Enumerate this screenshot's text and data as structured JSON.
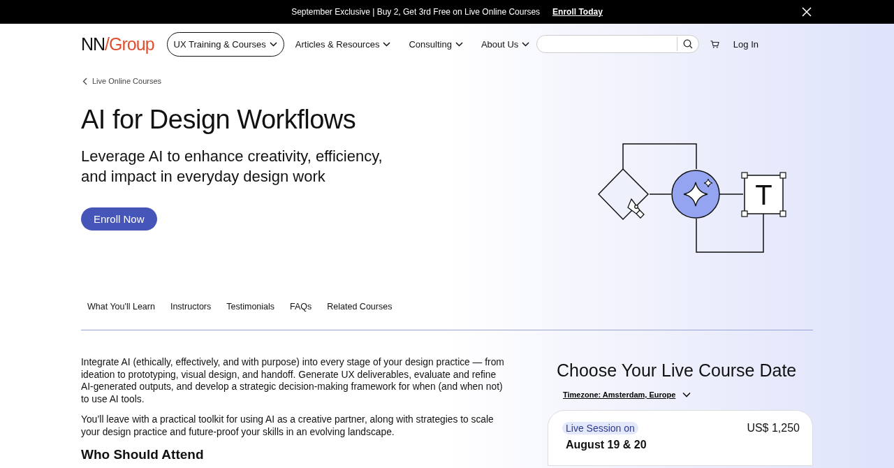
{
  "announcement": {
    "text": "September Exclusive | Buy 2, Get 3rd Free on Live Online Courses",
    "link": "Enroll Today"
  },
  "header": {
    "logo_left": "NN",
    "logo_slash": "/",
    "logo_right": "Group",
    "nav": [
      {
        "label": "UX Training & Courses",
        "selected": true
      },
      {
        "label": "Articles & Resources",
        "selected": false
      },
      {
        "label": "Consulting",
        "selected": false
      },
      {
        "label": "About Us",
        "selected": false
      }
    ],
    "login": "Log In"
  },
  "breadcrumb": "Live Online Courses",
  "hero": {
    "title": "AI for Design Workflows",
    "subtitle": "Leverage AI to enhance creativity, efficiency, and impact in everyday design work",
    "button": "Enroll Now",
    "illustration_letter": "T"
  },
  "tabs": [
    {
      "label": "What You'll Learn",
      "selected": false
    },
    {
      "label": "Instructors",
      "selected": false
    },
    {
      "label": "Testimonials",
      "selected": false
    },
    {
      "label": "FAQs",
      "selected": false
    },
    {
      "label": "Related Courses",
      "selected": false
    }
  ],
  "body": {
    "paragraphs": [
      "Integrate AI (ethically, effectively, and with purpose) into every stage of your design practice — from ideation to prototyping, visual design, and handoff. Generate UX deliverables, evaluate and refine AI-generated outputs, and develop a strategic decision-making framework for when (and when not) to use AI tools.",
      "You’ll leave with a practical toolkit for using AI as a creative partner, along with strategies to scale your design practice and future-proof your skills in an evolving landscape."
    ],
    "heading": "Who Should Attend"
  },
  "dates": {
    "heading": "Choose Your Live Course Date",
    "timezone": "Timezone: Amsterdam, Europe",
    "card": {
      "badge": "Live Session on",
      "price": "US$ 1,250",
      "date": "August 19 & 20"
    }
  }
}
